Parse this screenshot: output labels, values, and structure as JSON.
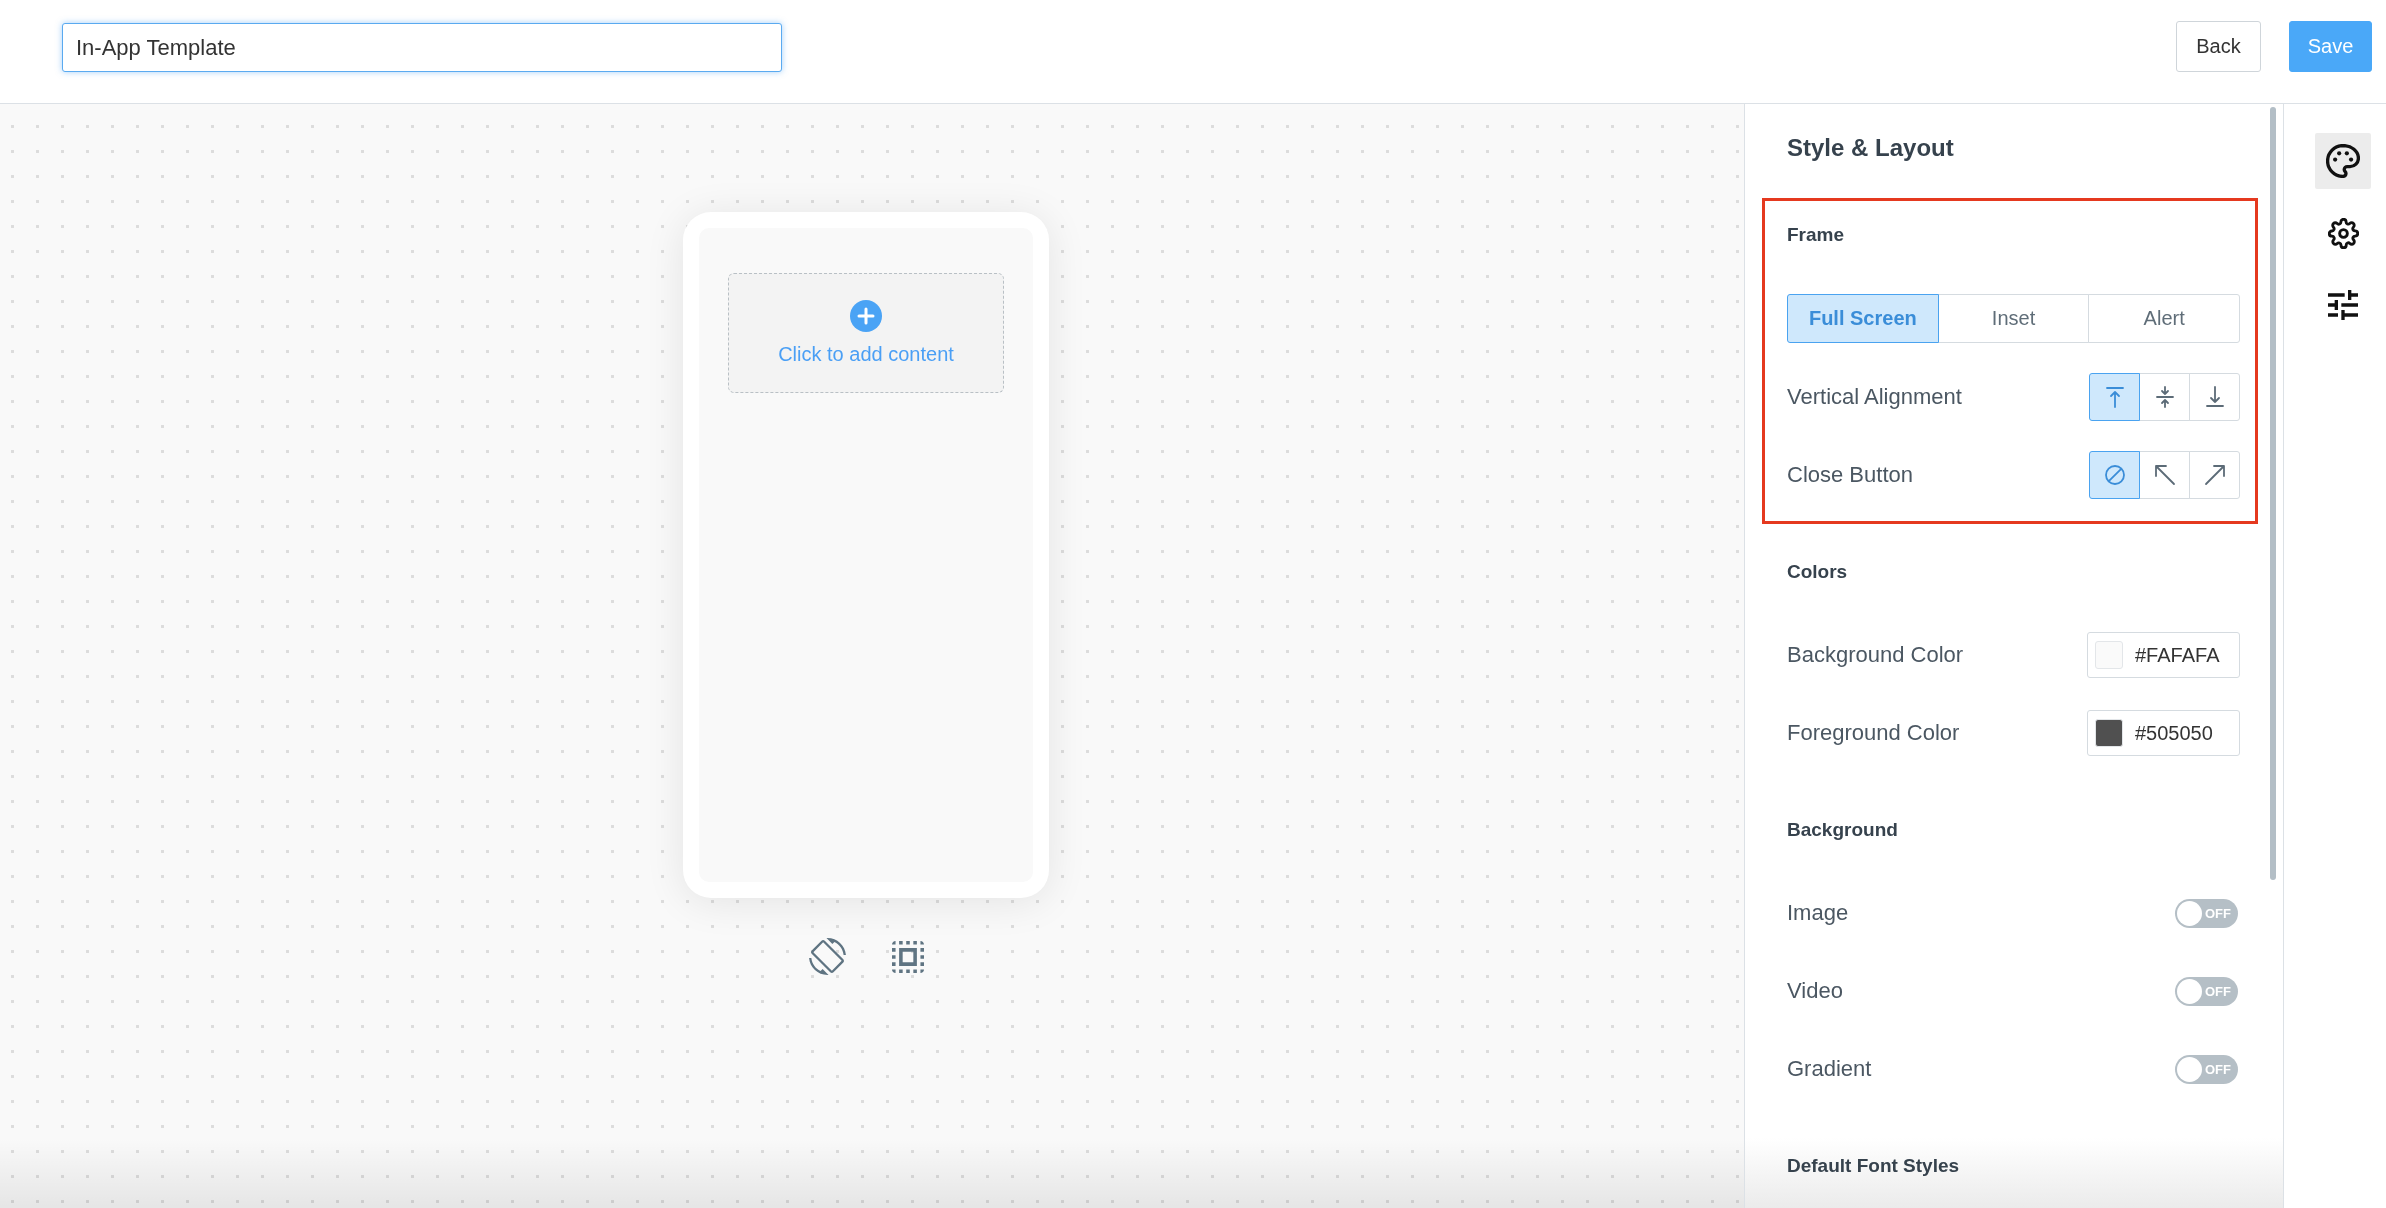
{
  "header": {
    "template_name": {
      "value": "In-App Template"
    },
    "buttons": [
      {
        "label": "Back",
        "kind": "back"
      },
      {
        "label": "Save",
        "kind": "save"
      }
    ]
  },
  "canvas": {
    "add_content": {
      "label": "Click to add content"
    }
  },
  "panel": {
    "title": "Style & Layout",
    "sections": [
      {
        "title": "Frame",
        "highlighted": true,
        "rows": [
          {
            "kind": "segmented",
            "options": [
              {
                "label": "Full Screen",
                "selected": true
              },
              {
                "label": "Inset",
                "selected": false
              },
              {
                "label": "Alert",
                "selected": false
              }
            ]
          },
          {
            "kind": "icon_group",
            "label": "Vertical Alignment",
            "options": [
              {
                "kind": "align_top",
                "selected": true
              },
              {
                "kind": "align_middle",
                "selected": false
              },
              {
                "kind": "align_bottom",
                "selected": false
              }
            ]
          },
          {
            "kind": "icon_group",
            "label": "Close Button",
            "options": [
              {
                "kind": "no_close",
                "selected": true
              },
              {
                "kind": "top_left",
                "selected": false
              },
              {
                "kind": "top_right",
                "selected": false
              }
            ]
          }
        ]
      },
      {
        "title": "Colors",
        "highlighted": false,
        "rows": [
          {
            "kind": "color",
            "label": "Background Color",
            "value": "#FAFAFA",
            "color": "#fafafa"
          },
          {
            "kind": "color",
            "label": "Foreground Color",
            "value": "#505050",
            "color": "#505050"
          }
        ]
      },
      {
        "title": "Background",
        "highlighted": false,
        "rows": [
          {
            "kind": "toggle",
            "label": "Image",
            "on": false,
            "toggle_text": "OFF"
          },
          {
            "kind": "toggle",
            "label": "Video",
            "on": false,
            "toggle_text": "OFF"
          },
          {
            "kind": "toggle",
            "label": "Gradient",
            "on": false,
            "toggle_text": "OFF"
          }
        ]
      },
      {
        "title": "Default Font Styles",
        "highlighted": false
      }
    ]
  },
  "rail": {
    "items": [
      {
        "kind": "palette",
        "selected": true
      },
      {
        "kind": "gear",
        "selected": false
      },
      {
        "kind": "sliders",
        "selected": false
      }
    ]
  }
}
